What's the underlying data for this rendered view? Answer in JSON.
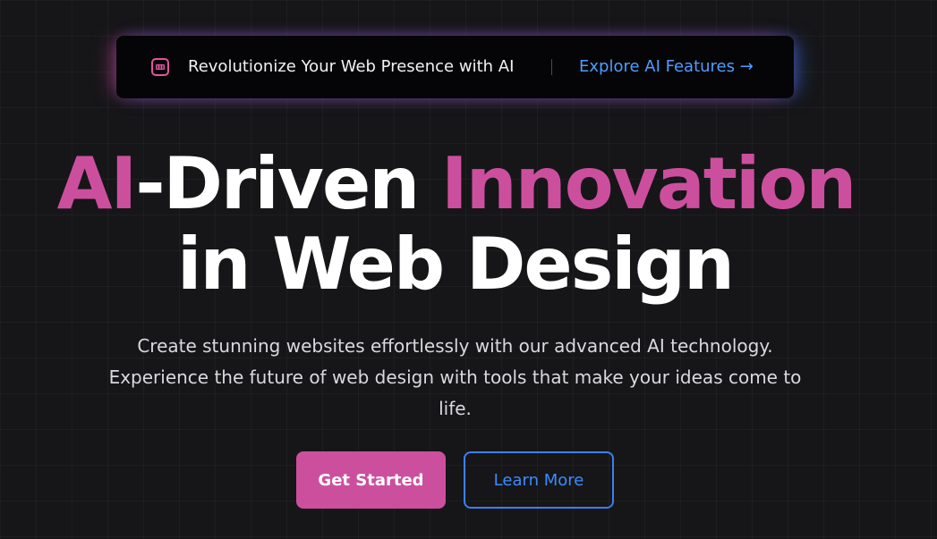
{
  "banner": {
    "icon": "calendar-icon",
    "text": "Revolutionize Your Web Presence with AI",
    "link_label": "Explore AI Features →"
  },
  "hero": {
    "headline_line1_part1": "AI",
    "headline_line1_part2": "-Driven ",
    "headline_line1_part3": "Innovation",
    "headline_line2": "in Web Design",
    "subtitle": "Create stunning websites effortlessly with our advanced AI technology. Experience the future of web design with tools that make your ideas come to life."
  },
  "actions": {
    "primary_label": "Get Started",
    "secondary_label": "Learn More"
  },
  "colors": {
    "accent_pink": "#cc4f9e",
    "accent_blue": "#3d8bff",
    "background": "#161618"
  }
}
